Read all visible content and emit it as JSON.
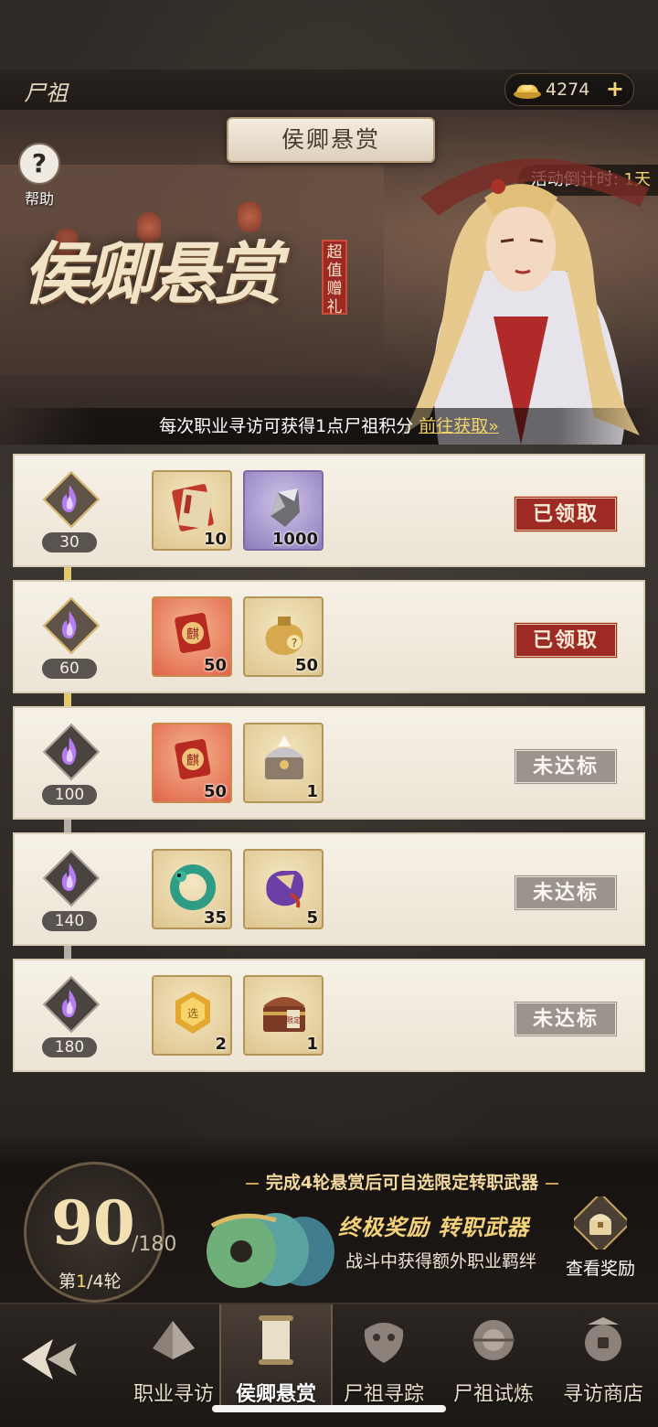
{
  "topbar": {
    "title": "尸祖",
    "currency_value": "4274",
    "add_symbol": "+"
  },
  "banner": {
    "title": "侯卿悬赏",
    "help_label": "帮助",
    "help_symbol": "?",
    "countdown_label": "活动倒计时:",
    "countdown_value": "1天",
    "calligraphy": "侯卿悬赏",
    "seal_text": "超值赠礼",
    "footer_text": "每次职业寻访可获得1点尸祖积分 ",
    "footer_link": "前往获取»"
  },
  "rows": [
    {
      "threshold": "30",
      "items": [
        {
          "name": "scroll-icon",
          "qty": "10"
        },
        {
          "name": "silver-ore-icon",
          "qty": "1000"
        }
      ],
      "status": "已领取",
      "reached": true
    },
    {
      "threshold": "60",
      "items": [
        {
          "name": "red-token-icon",
          "qty": "50"
        },
        {
          "name": "lucky-bag-icon",
          "qty": "50"
        }
      ],
      "status": "已领取",
      "reached": true
    },
    {
      "threshold": "100",
      "items": [
        {
          "name": "red-token-icon",
          "qty": "50"
        },
        {
          "name": "treasure-chest-icon",
          "qty": "1"
        }
      ],
      "status": "未达标",
      "reached": false
    },
    {
      "threshold": "140",
      "items": [
        {
          "name": "jade-dragon-ring-icon",
          "qty": "35"
        },
        {
          "name": "purple-bundle-icon",
          "qty": "5"
        }
      ],
      "status": "未达标",
      "reached": false
    },
    {
      "threshold": "180",
      "items": [
        {
          "name": "gold-coin-icon",
          "qty": "2"
        },
        {
          "name": "limited-chest-icon",
          "qty": "1"
        }
      ],
      "status": "未达标",
      "reached": false
    }
  ],
  "progress": {
    "current": "90",
    "max": "/180",
    "round_prefix": "第",
    "round_current": "1",
    "round_suffix": "/4轮"
  },
  "final_reward": {
    "notice": "完成4轮悬赏后可自选限定转职武器",
    "title": "终极奖励 转职武器",
    "subtitle": "战斗中获得额外职业羁绊",
    "view_label": "查看奖励"
  },
  "nav": {
    "tabs": [
      {
        "label": "职业寻访",
        "active": false
      },
      {
        "label": "侯卿悬赏",
        "active": true
      },
      {
        "label": "尸祖寻踪",
        "active": false
      },
      {
        "label": "尸祖试炼",
        "active": false
      },
      {
        "label": "寻访商店",
        "active": false
      }
    ]
  },
  "colors": {
    "claimed": "#9e2a24",
    "locked": "#9a948c",
    "accent_gold": "#f3d27a",
    "link": "#f0d669"
  }
}
